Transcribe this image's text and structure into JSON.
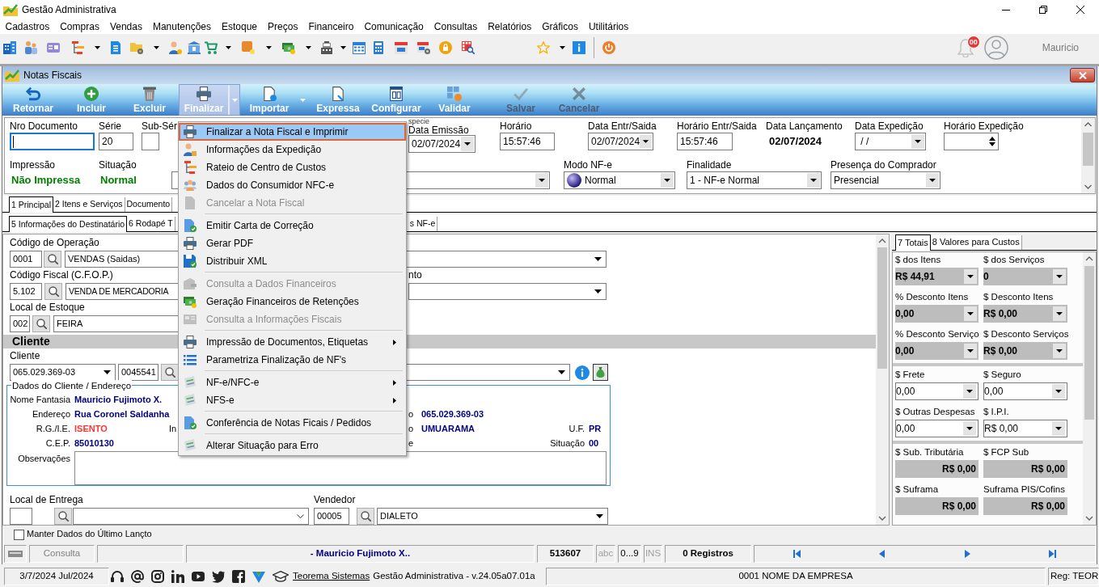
{
  "window": {
    "title": "Gestão Administrativa"
  },
  "menu_bar": [
    "Cadastros",
    "Compras",
    "Vendas",
    "Manutenções",
    "Estoque",
    "Preços",
    "Financeiro",
    "Comunicação",
    "Consultas",
    "Relatórios",
    "Gráficos",
    "Utilitários"
  ],
  "toolbar": {
    "notifications": "00",
    "user": "Mauricio"
  },
  "document_window": {
    "title": "Notas Fiscais",
    "toolbar": [
      {
        "label": "Retornar",
        "selected": false,
        "disabled": false,
        "dropdown": false
      },
      {
        "label": "Incluir",
        "selected": false,
        "disabled": false,
        "dropdown": false
      },
      {
        "label": "Excluir",
        "selected": false,
        "disabled": false,
        "dropdown": false
      },
      {
        "label": "Finalizar",
        "selected": true,
        "disabled": false,
        "dropdown": true
      },
      {
        "label": "Importar",
        "selected": false,
        "disabled": false,
        "dropdown": true
      },
      {
        "label": "Expressa",
        "selected": false,
        "disabled": false,
        "dropdown": false
      },
      {
        "label": "Configurar",
        "selected": false,
        "disabled": false,
        "dropdown": false
      },
      {
        "label": "Validar",
        "selected": false,
        "disabled": false,
        "dropdown": false
      },
      {
        "label": "Salvar",
        "selected": false,
        "disabled": true,
        "dropdown": false
      },
      {
        "label": "Cancelar",
        "selected": false,
        "disabled": true,
        "dropdown": false
      }
    ],
    "header": {
      "row_1": [
        {
          "kind": "input",
          "label": "Nro Documento",
          "focused": true
        },
        {
          "kind": "input",
          "label": "Série",
          "value": "20",
          "focused": false
        },
        {
          "kind": "input",
          "label": "Sub-Sér",
          "focused": false
        },
        {
          "kind": "date",
          "label": "Data Emissão",
          "label_above": "specie",
          "value": "02/07/2024",
          "focused": false
        },
        {
          "kind": "input",
          "label": "Horário",
          "value": "15:57:46",
          "focused": false
        },
        {
          "kind": "date",
          "label": "Data Entr/Saida",
          "value": "02/07/2024",
          "focused": false
        },
        {
          "kind": "input",
          "label": "Horário Entr/Saida",
          "value": "15:57:46",
          "focused": false
        },
        {
          "kind": "text",
          "label": "Data Lançamento",
          "value": "02/07/2024",
          "focused": false
        },
        {
          "kind": "date",
          "label": "Data Expedição",
          "value": " / /",
          "focused": false
        },
        {
          "kind": "spin",
          "label": "Horário Expedição",
          "focused": false
        }
      ],
      "row_2": [
        {
          "kind": "status",
          "label": "Impressão",
          "value": "Não Impressa"
        },
        {
          "kind": "status",
          "label": "Situação",
          "value": "Normal"
        },
        {
          "kind": "select"
        },
        {
          "kind": "mode",
          "label": "Modo NF-e",
          "value": "Normal"
        },
        {
          "kind": "select",
          "label": "Finalidade",
          "value": "1 - NF-e Normal"
        },
        {
          "kind": "select",
          "label": "Presença do Comprador",
          "value": "Presencial"
        }
      ]
    },
    "tabs": [
      {
        "label": "1 Principal",
        "selected": true
      },
      {
        "label": "2 Itens e Serviços",
        "selected": false
      },
      {
        "label": "Documento",
        "selected": false
      }
    ],
    "subtabs": [
      {
        "label": "5 Informações do Destinatário",
        "selected": true
      },
      {
        "label": "6 Rodapé T",
        "selected": false
      },
      {
        "label": "s NF-e",
        "selected": false
      }
    ],
    "recipient": {
      "operation": {
        "label": "Código de Operação",
        "code": "0001",
        "value": "VENDAS (Saidas)"
      },
      "cfop": {
        "label": "Código Fiscal (C.F.O.P.)",
        "code": "5.102",
        "value": "VENDA DE MERCADORIA",
        "side_label": "nto"
      },
      "stock": {
        "label": "Local de Estoque",
        "code": "002",
        "value": "FEIRA"
      },
      "client": {
        "section": "Cliente",
        "label": "Cliente",
        "document": "065.029.369-03",
        "code": "0045541"
      },
      "address": {
        "title": "Dados do Cliente / Endereço",
        "rows": [
          {
            "label": "Nome Fantasia",
            "value": "Mauricio Fujimoto X.",
            "color": "#000080"
          },
          {
            "label": "Endereço",
            "value": "Rua Coronel Saldanha",
            "color": "#000080",
            "right_label": "o",
            "right_value": "065.029.369-03"
          },
          {
            "label": "R.G./I.E.",
            "value": "ISENTO",
            "color": "#ff3333",
            "mid_label": "In",
            "right_label": "o",
            "right_value": "UMUARAMA",
            "far_label": "U.F.",
            "far_value": "PR"
          },
          {
            "label": "C.E.P.",
            "value": "85010130",
            "color": "#000080",
            "right_label": "e",
            "far_label": "Situação",
            "far_value": "00"
          }
        ],
        "notes_label": "Observações"
      },
      "delivery": {
        "label": "Local de Entrega"
      },
      "seller": {
        "label": "Vendedor",
        "code": "00005",
        "value": "DIALETO"
      }
    },
    "totals": {
      "tabs": [
        {
          "label": "7 Totais",
          "selected": true
        },
        {
          "label": "8 Valores para Custos",
          "selected": false
        }
      ],
      "groups": [
        [
          {
            "label": "$ dos Itens",
            "value": "R$ 44,91",
            "kind": "computed"
          },
          {
            "label": "$ dos Serviços",
            "value": "0",
            "kind": "computed"
          },
          {
            "label": "% Desconto Itens",
            "value": "0,00",
            "kind": "computed"
          },
          {
            "label": "$ Desconto Itens",
            "value": "R$ 0,00",
            "kind": "computed"
          },
          {
            "label": "% Desconto Serviço",
            "value": "0,00",
            "kind": "computed"
          },
          {
            "label": "$ Desconto Serviços",
            "value": "R$ 0,00",
            "kind": "computed"
          }
        ],
        [
          {
            "label": "$ Frete",
            "value": "0,00",
            "kind": "input"
          },
          {
            "label": "$ Seguro",
            "value": "0,00",
            "kind": "input"
          },
          {
            "label": "$ Outras Despesas",
            "value": "0,00",
            "kind": "input"
          },
          {
            "label": "$ I.P.I.",
            "value": "R$ 0,00",
            "kind": "input"
          }
        ],
        [
          {
            "label": "$ Sub. Tributária",
            "value": "R$ 0,00",
            "kind": "total"
          },
          {
            "label": "$ FCP Sub",
            "value": "R$ 0,00",
            "kind": "total"
          },
          {
            "label": "$ Suframa",
            "value": "R$ 0,00",
            "kind": "total"
          },
          {
            "label": "Suframa PIS/Cofins",
            "value": "R$ 0,00",
            "kind": "total"
          }
        ]
      ]
    },
    "keep_data": {
      "label": "Manter Dados do Último Lançto",
      "checked": false
    },
    "status_bar": {
      "mode": "Consulta",
      "customer": "- Mauricio Fujimoto X..",
      "number": "513607",
      "keys": [
        {
          "label": "abc",
          "on": false
        },
        {
          "label": "0...9",
          "on": true
        },
        {
          "label": "INS",
          "on": false
        }
      ],
      "records": "0 Registros"
    }
  },
  "finalize_menu": [
    {
      "kind": "item",
      "label": "Finalizar a Nota Fiscal e Imprimir",
      "selected": true,
      "disabled": false,
      "submenu": false
    },
    {
      "kind": "item",
      "label": "Informações da Expedição",
      "selected": false,
      "disabled": false,
      "submenu": false
    },
    {
      "kind": "item",
      "label": "Rateio de Centro de Custos",
      "selected": false,
      "disabled": false,
      "submenu": false
    },
    {
      "kind": "item",
      "label": "Dados do Consumidor NFC-e",
      "selected": false,
      "disabled": false,
      "submenu": false
    },
    {
      "kind": "item",
      "label": "Cancelar a Nota Fiscal",
      "selected": false,
      "disabled": true,
      "submenu": false
    },
    {
      "kind": "separator"
    },
    {
      "kind": "item",
      "label": "Emitir Carta de Correção",
      "selected": false,
      "disabled": false,
      "submenu": false
    },
    {
      "kind": "item",
      "label": "Gerar PDF",
      "selected": false,
      "disabled": false,
      "submenu": false
    },
    {
      "kind": "item",
      "label": "Distribuir XML",
      "selected": false,
      "disabled": false,
      "submenu": false
    },
    {
      "kind": "separator"
    },
    {
      "kind": "item",
      "label": "Consulta a Dados Financeiros",
      "selected": false,
      "disabled": true,
      "submenu": false
    },
    {
      "kind": "item",
      "label": "Geração Financeiros de Retenções",
      "selected": false,
      "disabled": false,
      "submenu": false
    },
    {
      "kind": "item",
      "label": "Consulta a Informações Fiscais",
      "selected": false,
      "disabled": true,
      "submenu": false
    },
    {
      "kind": "separator"
    },
    {
      "kind": "item",
      "label": "Impressão de Documentos, Etiquetas",
      "selected": false,
      "disabled": false,
      "submenu": true
    },
    {
      "kind": "item",
      "label": "Parametriza Finalização de NF's",
      "selected": false,
      "disabled": false,
      "submenu": false
    },
    {
      "kind": "separator"
    },
    {
      "kind": "item",
      "label": "NF-e/NFC-e",
      "selected": false,
      "disabled": false,
      "submenu": true
    },
    {
      "kind": "item",
      "label": "NFS-e",
      "selected": false,
      "disabled": false,
      "submenu": true
    },
    {
      "kind": "separator"
    },
    {
      "kind": "item",
      "label": "Conferência de Notas Ficais / Pedidos",
      "selected": false,
      "disabled": false,
      "submenu": false
    },
    {
      "kind": "separator"
    },
    {
      "kind": "item",
      "label": "Alterar Situação para Erro",
      "selected": false,
      "disabled": false,
      "submenu": false
    }
  ],
  "footer": {
    "date": "3/7/2024 Jul/2024",
    "link": "Teorema Sistemas",
    "version": "Gestão Administrativa - v.24.05a07.01a",
    "company": "0001 NOME DA EMPRESA",
    "registration": "Reg: TEOR"
  }
}
